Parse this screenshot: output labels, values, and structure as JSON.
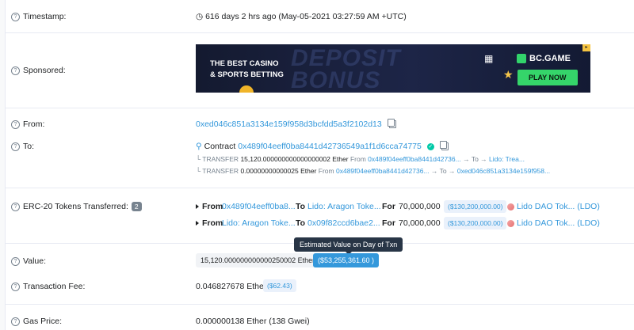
{
  "timestamp": {
    "label": "Timestamp:",
    "value": "616 days 2 hrs ago (May-05-2021 03:27:59 AM +UTC)"
  },
  "sponsored": {
    "label": "Sponsored:",
    "ad": {
      "headline1": "THE BEST CASINO",
      "headline2": "& SPORTS BETTING",
      "ghost_text1": "DEPOSIT",
      "ghost_text2": "BONUS",
      "brand": "BC.GAME",
      "cta": "PLAY NOW"
    }
  },
  "from": {
    "label": "From:",
    "address": "0xed046c851a3134e159f958d3bcfdd5a3f2102d13"
  },
  "to": {
    "label": "To:",
    "prefix": "Contract",
    "address": "0x489f04eeff0ba8441d42736549a1f1d6cca74775",
    "transfers": [
      {
        "kind": "TRANSFER",
        "amount": "15,120.000000000000000002 Ether",
        "from_label": "From",
        "from_addr": "0x489f04eeff0ba8441d42736...",
        "to_label": "To",
        "to_addr": "Lido: Trea..."
      },
      {
        "kind": "TRANSFER",
        "amount": "0.00000000000025 Ether",
        "from_label": "From",
        "from_addr": "0x489f04eeff0ba8441d42736...",
        "to_label": "To",
        "to_addr": "0xed046c851a3134e159f958..."
      }
    ]
  },
  "erc20": {
    "label": "ERC-20 Tokens Transferred:",
    "count": "2",
    "rows": [
      {
        "from_label": "From",
        "from": "0x489f04eeff0ba8...",
        "to_label": "To",
        "to": "Lido: Aragon Toke...",
        "for_label": "For",
        "amount": "70,000,000",
        "usd": "($130,200,000.00)",
        "token": "Lido DAO Tok... (LDO)"
      },
      {
        "from_label": "From",
        "from": "Lido: Aragon Toke...",
        "to_label": "To",
        "to": "0x09f82ccd6bae2...",
        "for_label": "For",
        "amount": "70,000,000",
        "usd": "($130,200,000.00)",
        "token": "Lido DAO Tok... (LDO)"
      }
    ]
  },
  "tooltip": "Estimated Value on Day of Txn",
  "value": {
    "label": "Value:",
    "ether": "15,120.000000000000250002 Ether",
    "usd": "($53,255,361.60 )"
  },
  "fee": {
    "label": "Transaction Fee:",
    "value": "0.046827678 Ether",
    "usd": "($62.43)"
  },
  "gas": {
    "label": "Gas Price:",
    "value": "0.000000138 Ether (138 Gwei)"
  },
  "colors": {
    "link": "#3498db",
    "muted": "#77838f",
    "ad_cta": "#35d56a"
  }
}
